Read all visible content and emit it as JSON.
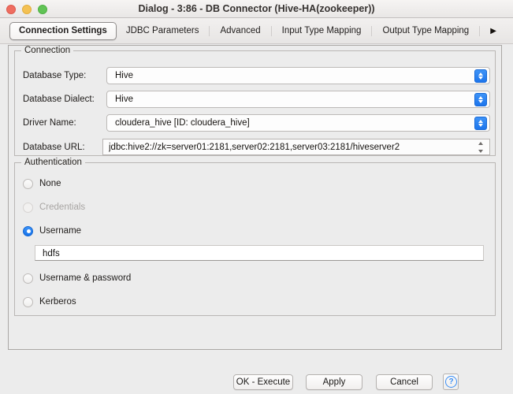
{
  "window": {
    "title": "Dialog - 3:86 - DB Connector (Hive-HA(zookeeper))",
    "traffic_lights": [
      "close-button",
      "minimize-button",
      "maximize-button"
    ]
  },
  "tabs": [
    {
      "label": "Connection Settings",
      "selected": true
    },
    {
      "label": "JDBC Parameters",
      "selected": false
    },
    {
      "label": "Advanced",
      "selected": false
    },
    {
      "label": "Input Type Mapping",
      "selected": false
    },
    {
      "label": "Output Type Mapping",
      "selected": false
    }
  ],
  "tab_overflow": {
    "icon": "chevron-right-icon",
    "glyph": "▶"
  },
  "connection": {
    "group_title": "Connection",
    "fields": [
      {
        "label": "Database Type:",
        "value": "Hive",
        "control": "combobox"
      },
      {
        "label": "Database Dialect:",
        "value": "Hive",
        "control": "combobox"
      },
      {
        "label": "Driver Name:",
        "value": "cloudera_hive [ID: cloudera_hive]",
        "control": "combobox"
      },
      {
        "label": "Database URL:",
        "value": "jdbc:hive2://zk=server01:2181,server02:2181,server03:2181/hiveserver2",
        "control": "editable-combobox"
      }
    ]
  },
  "authentication": {
    "group_title": "Authentication",
    "options": [
      {
        "label": "None",
        "checked": false,
        "disabled": false
      },
      {
        "label": "Credentials",
        "checked": false,
        "disabled": true
      },
      {
        "label": "Username",
        "checked": true,
        "disabled": false
      },
      {
        "label": "Username & password",
        "checked": false,
        "disabled": false
      },
      {
        "label": "Kerberos",
        "checked": false,
        "disabled": false
      }
    ],
    "username_field": {
      "value": "hdfs",
      "placeholder": ""
    }
  },
  "buttons": {
    "ok": "OK - Execute",
    "apply": "Apply",
    "cancel": "Cancel",
    "help_icon": "help-circle-icon",
    "help_glyph": "?"
  },
  "colors": {
    "accent_blue": "#1d75ec",
    "window_bg": "#ececec",
    "field_bg": "#fdfdfd",
    "help_blue": "#3b8ef4",
    "disabled_text": "#a8a5a3"
  }
}
